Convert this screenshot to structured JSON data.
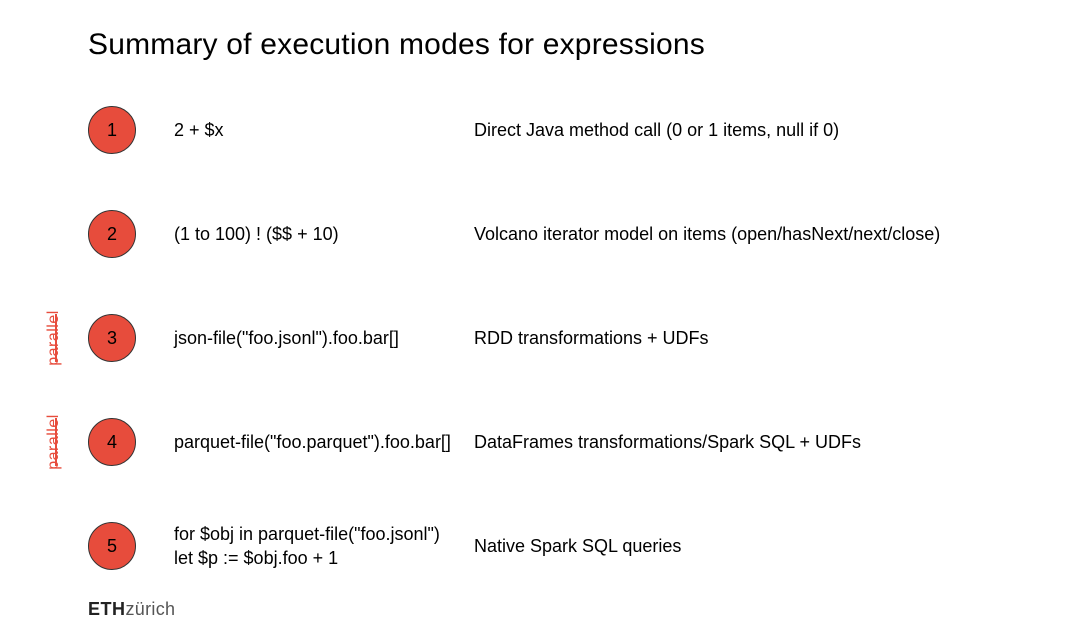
{
  "title": "Summary of execution modes for expressions",
  "rows": [
    {
      "num": "1",
      "expr": "2 + $x",
      "desc": "Direct Java method call (0 or 1 items, null if 0)",
      "parallel": false
    },
    {
      "num": "2",
      "expr": "(1 to 100) ! ($$ + 10)",
      "desc": "Volcano iterator model on items (open/hasNext/next/close)",
      "parallel": false
    },
    {
      "num": "3",
      "expr": "json-file(\"foo.jsonl\").foo.bar[]",
      "desc": "RDD transformations + UDFs",
      "parallel": true
    },
    {
      "num": "4",
      "expr": "parquet-file(\"foo.parquet\").foo.bar[]",
      "desc": "DataFrames transformations/Spark SQL + UDFs",
      "parallel": true
    },
    {
      "num": "5",
      "expr": "for $obj in parquet-file(\"foo.jsonl\")\nlet $p := $obj.foo + 1",
      "desc": "Native Spark SQL queries",
      "parallel": false
    }
  ],
  "parallel_label": "parallel",
  "footer": {
    "eth": "ETH",
    "zurich": "zürich"
  }
}
